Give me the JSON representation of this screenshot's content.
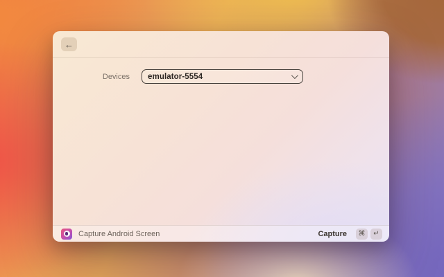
{
  "window": {
    "header": {
      "back_icon_glyph": "←"
    },
    "form": {
      "devices_label": "Devices",
      "device_dropdown": {
        "selected_value": "emulator-5554"
      }
    },
    "footer": {
      "app_name": "Capture Android Screen",
      "primary_action": {
        "label": "Capture",
        "shortcut_keys": [
          "⌘",
          "↵"
        ]
      }
    }
  },
  "colors": {
    "window_bg_warm": "#f8e9d3",
    "window_bg_cool": "#e9e5f5",
    "dropdown_border": "#46413b",
    "app_icon_gradient_start": "#e8557d",
    "app_icon_gradient_end": "#8456d6",
    "desktop_orange": "#f28a3e",
    "desktop_yellow": "#f0bf4e",
    "desktop_red": "#ef5348",
    "desktop_purple": "#8b7cc4"
  }
}
